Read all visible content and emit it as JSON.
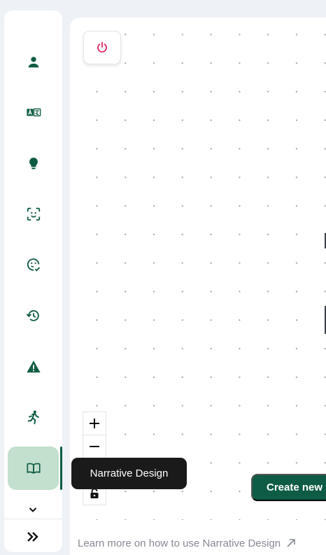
{
  "tooltip": {
    "text": "Narrative Design"
  },
  "actions": {
    "create_new_label": "Create new"
  },
  "footer": {
    "learn_more_label": "Learn more on how to use Narrative Design"
  },
  "zoom": {
    "zoom_in": "+",
    "zoom_out": "−"
  },
  "sidebar": {
    "items": [
      {
        "icon": "person-icon"
      },
      {
        "icon": "translate-icon"
      },
      {
        "icon": "lightbulb-icon"
      },
      {
        "icon": "face-scan-icon"
      },
      {
        "icon": "face-check-icon"
      },
      {
        "icon": "history-icon"
      },
      {
        "icon": "warning-icon"
      },
      {
        "icon": "running-icon"
      },
      {
        "icon": "book-icon",
        "active": true
      }
    ],
    "expand_icon": "chevron-down-icon",
    "collapse_icon": "double-chevron-right-icon"
  },
  "colors": {
    "accent": "#0f5c44",
    "active_bg": "#c3dfcd",
    "power_icon": "#e0245e",
    "tooltip_bg": "#1a1a1a",
    "link_text": "#868a92"
  }
}
